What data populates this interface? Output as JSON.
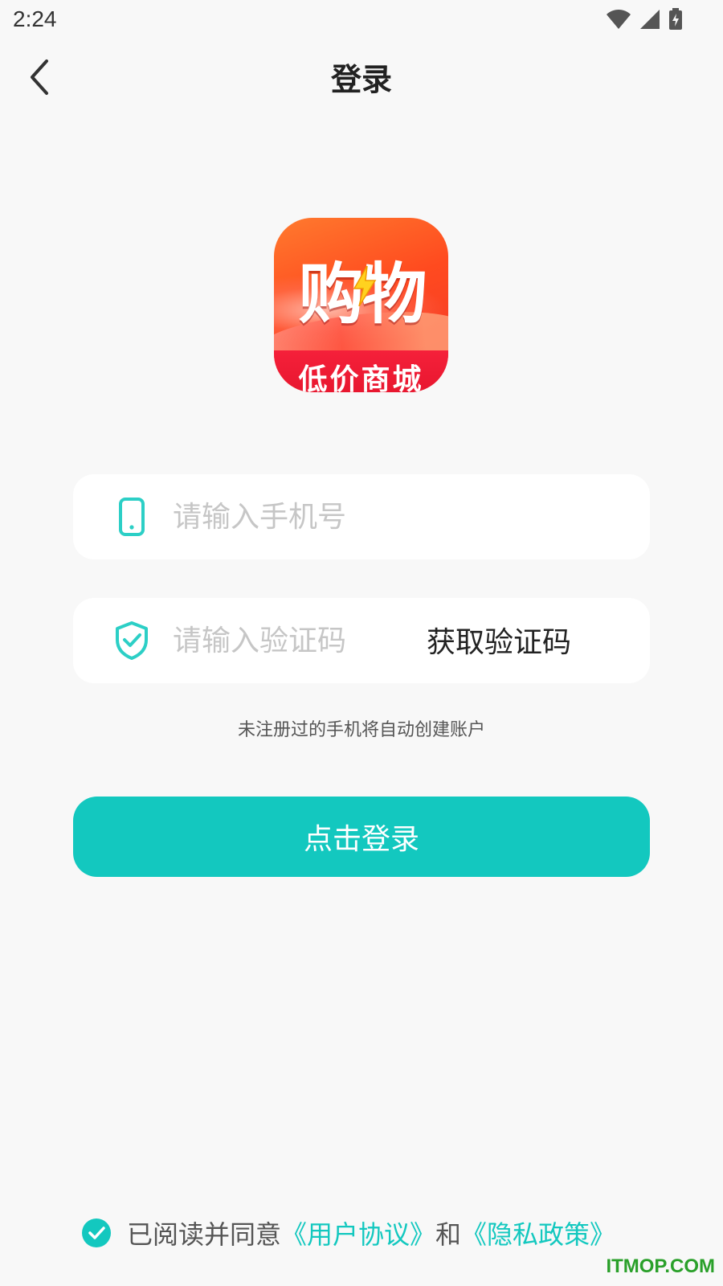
{
  "status_bar": {
    "time": "2:24",
    "icons": [
      "wifi-icon",
      "cellular-signal-icon",
      "battery-charging-icon"
    ]
  },
  "navbar": {
    "title": "登录",
    "back_icon": "chevron-left-icon"
  },
  "logo": {
    "main_text": "购物",
    "sub_text": "低价商城"
  },
  "form": {
    "phone": {
      "icon": "mobile-phone-icon",
      "value": "",
      "placeholder": "请输入手机号"
    },
    "code": {
      "icon": "shield-check-icon",
      "value": "",
      "placeholder": "请输入验证码",
      "get_code_label": "获取验证码"
    },
    "hint": "未注册过的手机将自动创建账户",
    "login_label": "点击登录"
  },
  "agreement": {
    "checked": true,
    "prefix": "已阅读并同意",
    "user_agreement": "《用户协议》",
    "and": "和",
    "privacy_policy": "《隐私政策》"
  },
  "watermark": "ITMOP.COM",
  "colors": {
    "accent": "#13c8bf",
    "background": "#f8f8f8",
    "watermark": "#2aa02a"
  }
}
